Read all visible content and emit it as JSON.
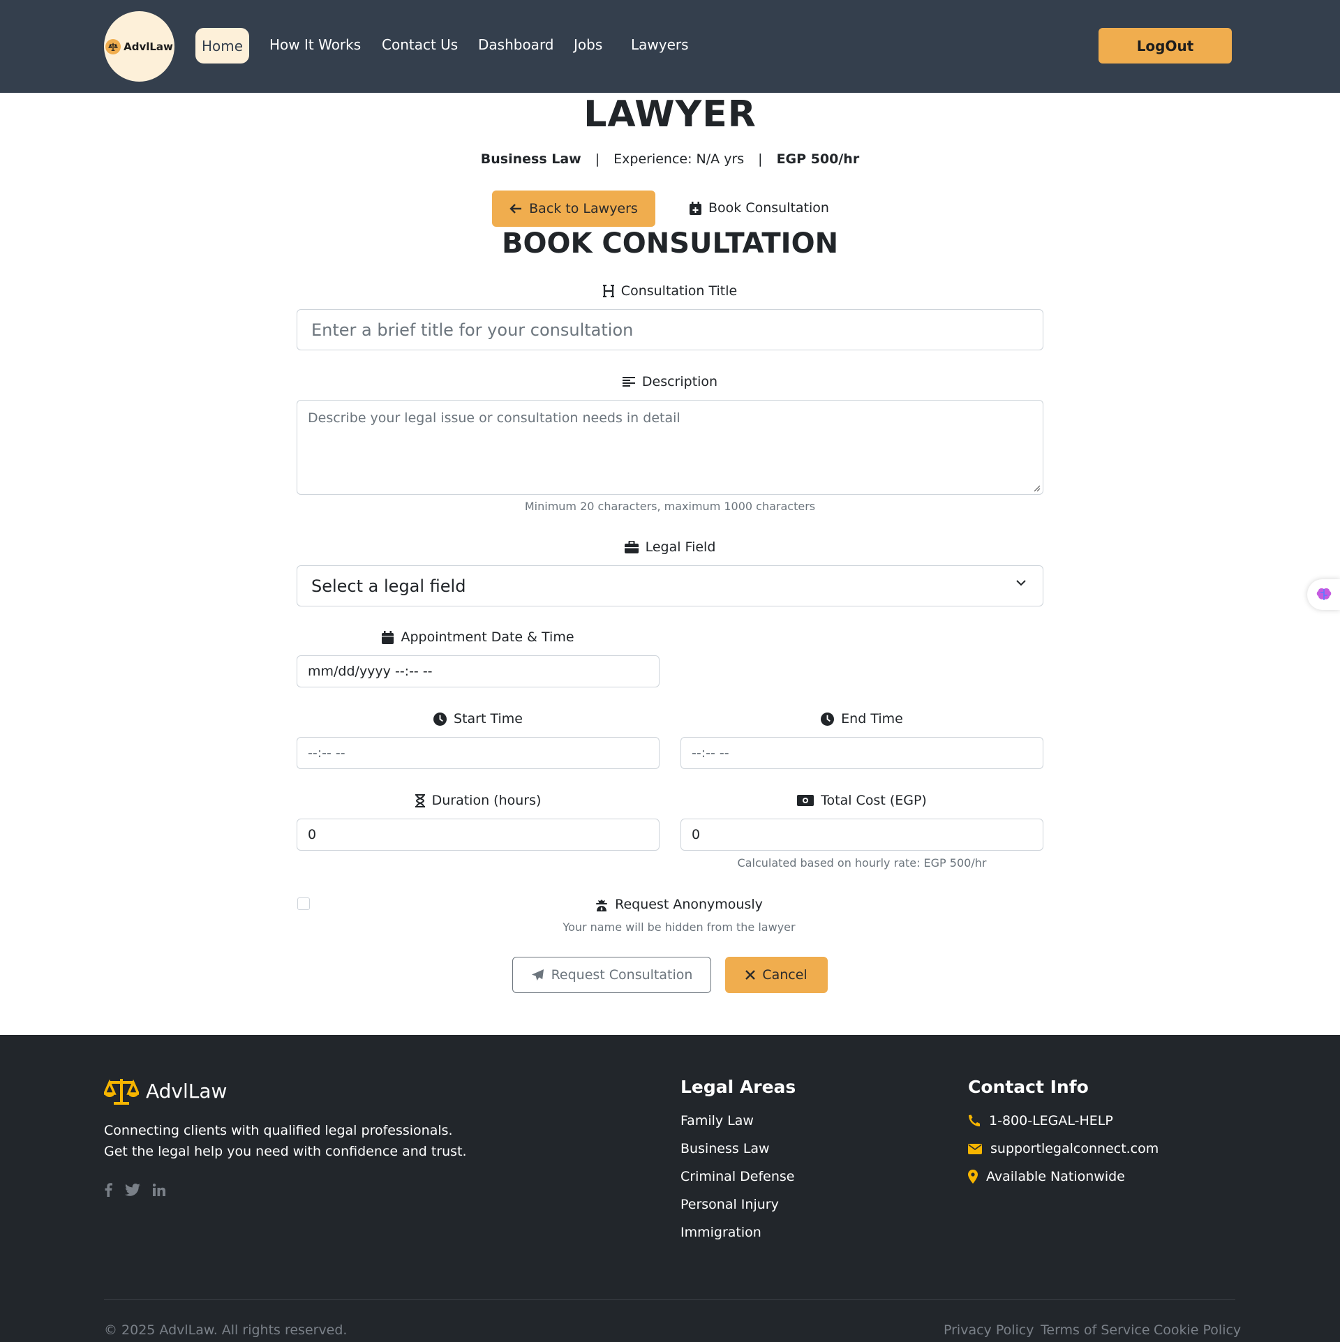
{
  "nav": {
    "logo_text": "AdvlLaw",
    "items": [
      "Home",
      "How It Works",
      "Contact Us",
      "Dashboard",
      "Jobs",
      "Lawyers"
    ],
    "logout": "LogOut"
  },
  "profile": {
    "name": "LAWYER",
    "specialty": "Business Law",
    "separator": "|",
    "experience": "Experience: N/A yrs",
    "rate": "EGP 500/hr",
    "back_button": "Back to Lawyers",
    "book_tab": "Book Consultation"
  },
  "form": {
    "title": "BOOK CONSULTATION",
    "consultation_title": {
      "label": "Consultation Title",
      "placeholder": "Enter a brief title for your consultation"
    },
    "description": {
      "label": "Description",
      "placeholder": "Describe your legal issue or consultation needs in detail",
      "hint": "Minimum 20 characters, maximum 1000 characters"
    },
    "legal_field": {
      "label": "Legal Field",
      "selected": "Select a legal field"
    },
    "appointment": {
      "label": "Appointment Date & Time",
      "value": "mm/dd/yyyy --:-- --"
    },
    "start_time": {
      "label": "Start Time",
      "value": "--:-- --"
    },
    "end_time": {
      "label": "End Time",
      "value": "--:-- --"
    },
    "duration": {
      "label": "Duration (hours)",
      "value": "0"
    },
    "total_cost": {
      "label": "Total Cost (EGP)",
      "value": "0",
      "hint": "Calculated based on hourly rate: EGP 500/hr"
    },
    "anonymous": {
      "label": "Request Anonymously",
      "hint": "Your name will be hidden from the lawyer",
      "checked": false
    },
    "submit": "Request Consultation",
    "cancel": "Cancel"
  },
  "footer": {
    "brand": "AdvlLaw",
    "description": "Connecting clients with qualified legal professionals. Get the legal help you need with confidence and trust.",
    "social_icons": [
      "facebook-icon",
      "twitter-icon",
      "linkedin-icon"
    ],
    "legal_areas": {
      "heading": "Legal Areas",
      "items": [
        "Family Law",
        "Business Law",
        "Criminal Defense",
        "Personal Injury",
        "Immigration"
      ]
    },
    "contact": {
      "heading": "Contact Info",
      "phone": "1-800-LEGAL-HELP",
      "email": "supportlegalconnect.com",
      "location": "Available Nationwide"
    },
    "copyright": "© 2025 AdvlLaw. All rights reserved.",
    "legal_links": [
      "Privacy Policy",
      "Terms of Service",
      "Cookie Policy"
    ]
  },
  "colors": {
    "navbar": "#343f4d",
    "accent": "#f0ad4e",
    "footer": "#22262b"
  }
}
